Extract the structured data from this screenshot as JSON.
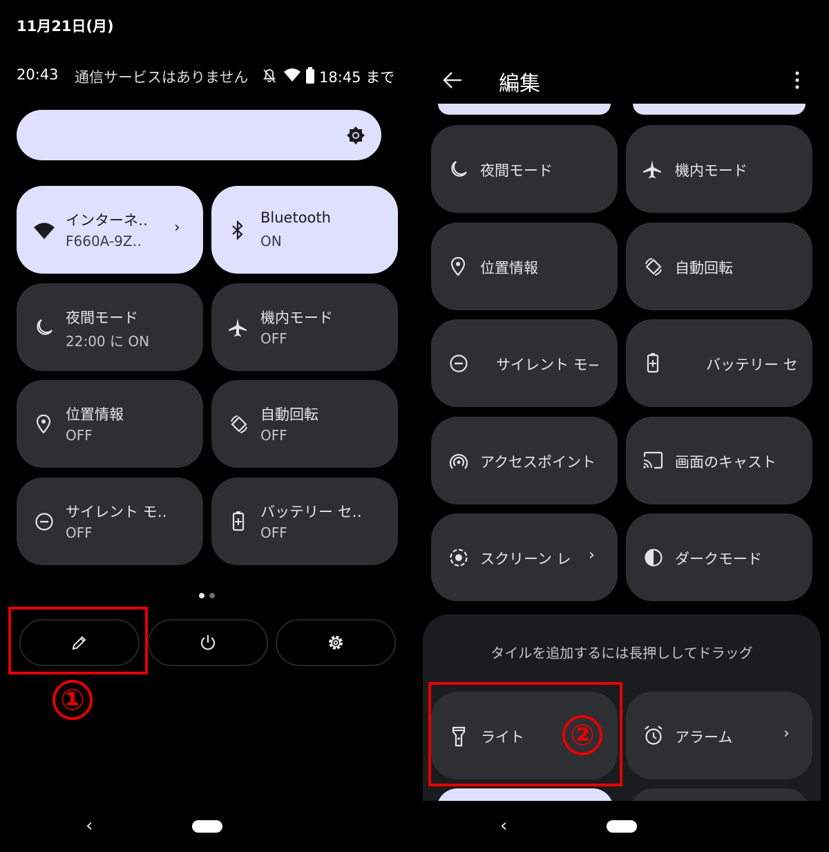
{
  "left": {
    "date": "11月21日(月)",
    "status": {
      "time": "20:43",
      "network": "通信サービスはありません",
      "battery_until": "18:45 まで"
    },
    "tiles": [
      {
        "title": "インターネ‥",
        "sub": "F660A-9Z‥",
        "icon": "wifi-icon",
        "on": true,
        "chevron": true
      },
      {
        "title": "Bluetooth",
        "sub": "ON",
        "icon": "bluetooth-icon",
        "on": true
      },
      {
        "title": "夜間モード",
        "sub": "22:00 に ON",
        "icon": "moon-icon"
      },
      {
        "title": "機内モード",
        "sub": "OFF",
        "icon": "airplane-icon"
      },
      {
        "title": "位置情報",
        "sub": "OFF",
        "icon": "location-icon"
      },
      {
        "title": "自動回転",
        "sub": "OFF",
        "icon": "rotate-icon"
      },
      {
        "title": "サイレント モ‥",
        "sub": "OFF",
        "icon": "dnd-icon"
      },
      {
        "title": "バッテリー セ‥",
        "sub": "OFF",
        "icon": "battery-saver-icon"
      }
    ],
    "annotation": "①"
  },
  "right": {
    "title": "編集",
    "tiles": [
      {
        "label": "夜間モード",
        "icon": "moon-icon"
      },
      {
        "label": "機内モード",
        "icon": "airplane-icon"
      },
      {
        "label": "位置情報",
        "icon": "location-icon"
      },
      {
        "label": "自動回転",
        "icon": "rotate-icon"
      },
      {
        "label": "サイレント モ−",
        "icon": "dnd-icon"
      },
      {
        "label": "バッテリー セ",
        "icon": "battery-saver-icon"
      },
      {
        "label": "アクセスポイント",
        "icon": "hotspot-icon"
      },
      {
        "label": "画面のキャスト",
        "icon": "cast-icon"
      },
      {
        "label": "スクリーン レ",
        "icon": "screen-record-icon",
        "chevron": true
      },
      {
        "label": "ダークモード",
        "icon": "dark-mode-icon"
      }
    ],
    "add_hint": "タイルを追加するには長押ししてドラッグ",
    "available": [
      {
        "label": "ライト",
        "icon": "flashlight-icon"
      },
      {
        "label": "アラーム",
        "icon": "alarm-icon",
        "chevron": true
      }
    ],
    "annotation": "②"
  },
  "colors": {
    "tile": "#2e2f33",
    "tile_on": "#dfe0ff",
    "annotation": "#e60000"
  }
}
